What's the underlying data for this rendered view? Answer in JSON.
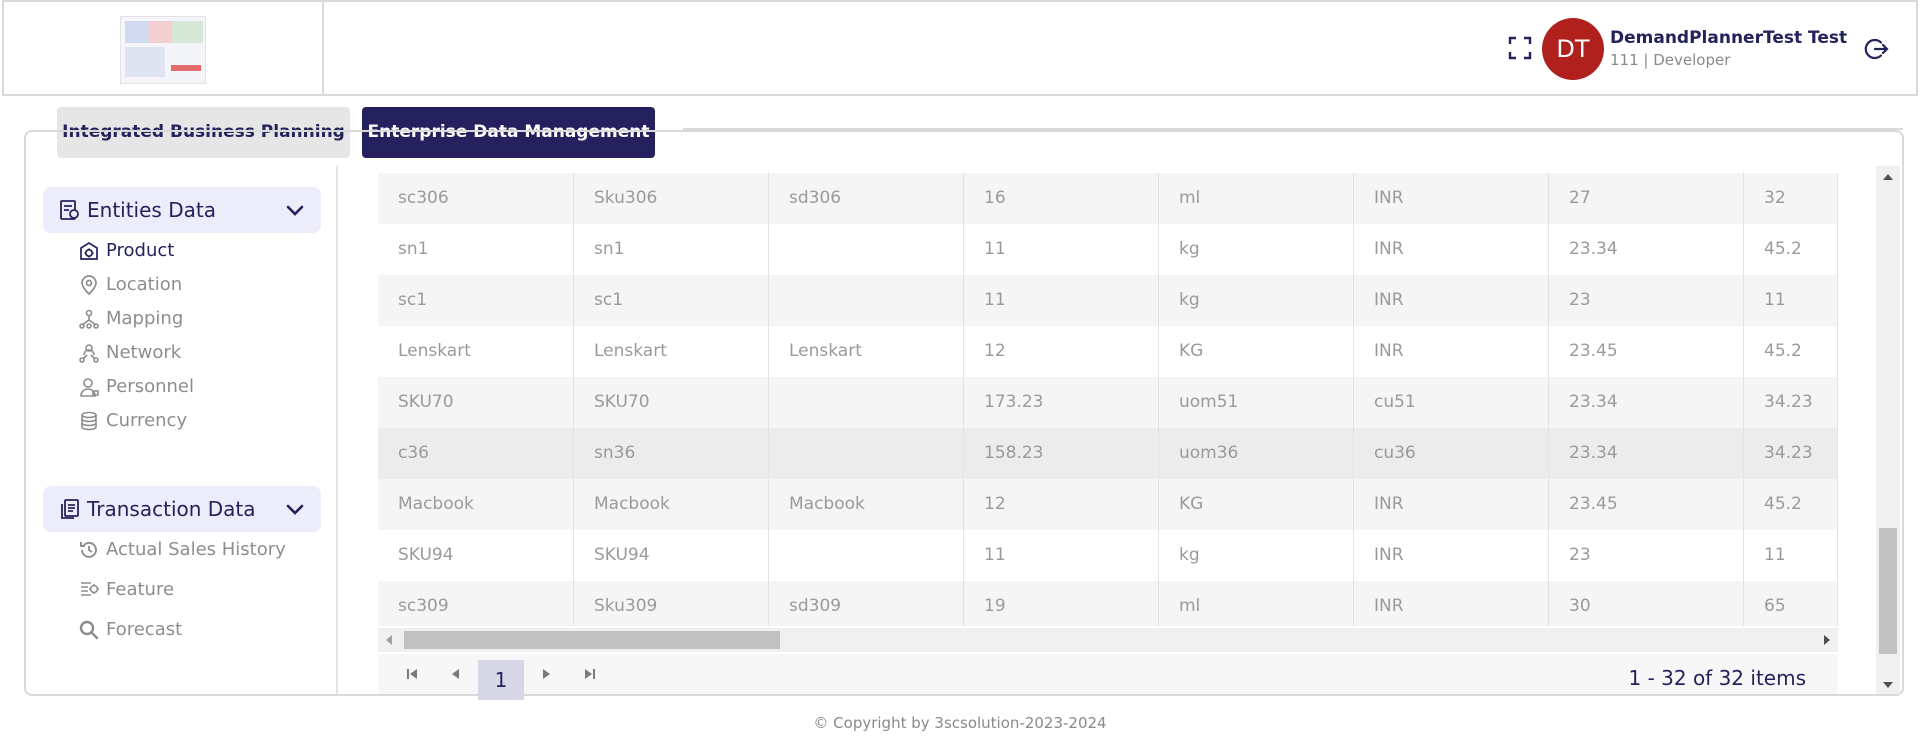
{
  "header": {
    "user_initials": "DT",
    "user_name": "DemandPlannerTest Test",
    "user_role": "111 | Developer",
    "avatar_color": "#b0201d"
  },
  "tabs": [
    {
      "label": "Integrated Business Planning",
      "active": false
    },
    {
      "label": "Enterprise Data Management",
      "active": true
    }
  ],
  "sidebar": {
    "groups": [
      {
        "label": "Entities Data",
        "icon": "entities-icon",
        "items": [
          {
            "label": "Product",
            "icon": "product-icon",
            "active": true
          },
          {
            "label": "Location",
            "icon": "location-pin-icon"
          },
          {
            "label": "Mapping",
            "icon": "mapping-icon"
          },
          {
            "label": "Network",
            "icon": "network-icon"
          },
          {
            "label": "Personnel",
            "icon": "personnel-icon"
          },
          {
            "label": "Currency",
            "icon": "currency-coins-icon"
          }
        ]
      },
      {
        "label": "Transaction Data",
        "icon": "transaction-icon",
        "items": [
          {
            "label": "Actual Sales History",
            "icon": "history-icon"
          },
          {
            "label": "Feature",
            "icon": "feature-icon"
          },
          {
            "label": "Forecast",
            "icon": "search-icon"
          }
        ]
      }
    ]
  },
  "grid": {
    "rows": [
      [
        "sc306",
        "Sku306",
        "sd306",
        "16",
        "ml",
        "INR",
        "27",
        "32"
      ],
      [
        "sn1",
        "sn1",
        "",
        "11",
        "kg",
        "INR",
        "23.34",
        "45.2"
      ],
      [
        "sc1",
        "sc1",
        "",
        "11",
        "kg",
        "INR",
        "23",
        "11"
      ],
      [
        "Lenskart",
        "Lenskart",
        "Lenskart",
        "12",
        "KG",
        "INR",
        "23.45",
        "45.2"
      ],
      [
        "SKU70",
        "SKU70",
        "",
        "173.23",
        "uom51",
        "cu51",
        "23.34",
        "34.23"
      ],
      [
        "c36",
        "sn36",
        "",
        "158.23",
        "uom36",
        "cu36",
        "23.34",
        "34.23"
      ],
      [
        "Macbook",
        "Macbook",
        "Macbook",
        "12",
        "KG",
        "INR",
        "23.45",
        "45.2"
      ],
      [
        "SKU94",
        "SKU94",
        "",
        "11",
        "kg",
        "INR",
        "23",
        "11"
      ],
      [
        "sc309",
        "Sku309",
        "sd309",
        "19",
        "ml",
        "INR",
        "30",
        "65"
      ]
    ]
  },
  "pager": {
    "current_page": "1",
    "info": "1 - 32 of 32 items"
  },
  "footer": {
    "copyright": "© Copyright by 3scsolution-2023-2024"
  }
}
